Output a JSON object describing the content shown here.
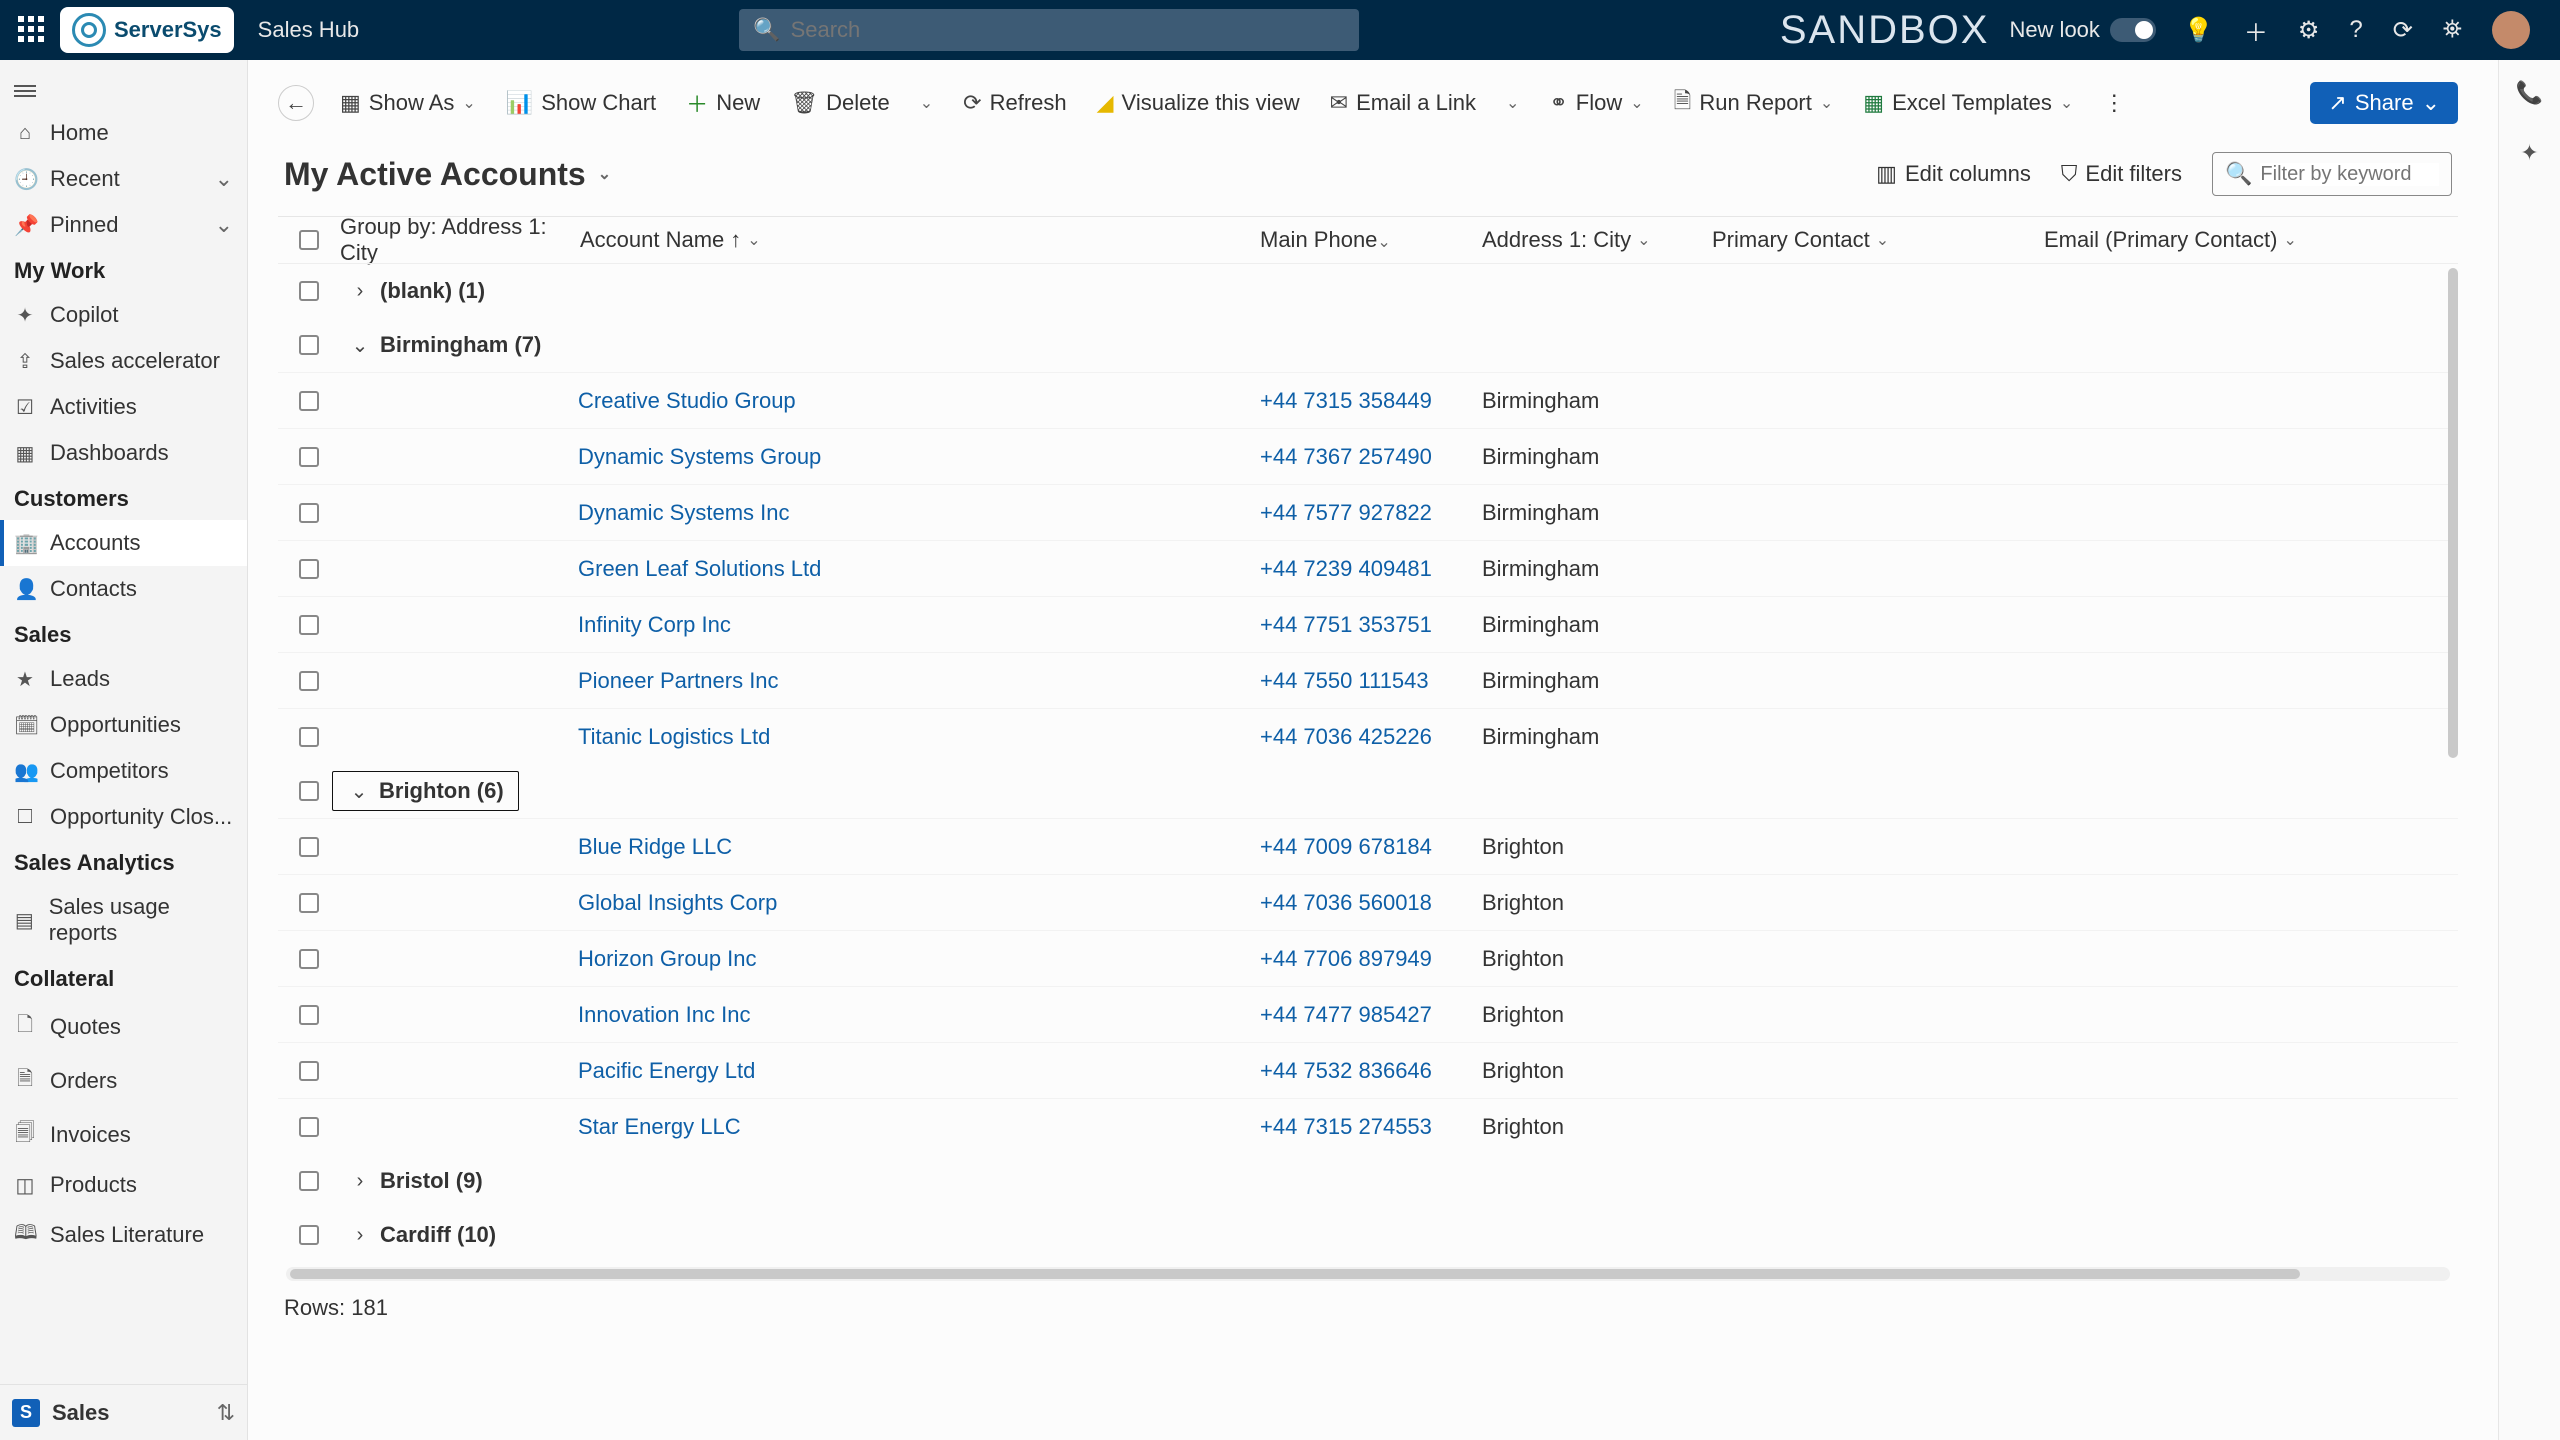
{
  "header": {
    "logo": "ServerSys",
    "app": "Sales Hub",
    "search_placeholder": "Search",
    "sandbox": "SANDBOX",
    "newlook": "New look"
  },
  "nav": {
    "top": [
      {
        "icon": "⌂",
        "label": "Home"
      },
      {
        "icon": "🕘",
        "label": "Recent",
        "chev": true
      },
      {
        "icon": "📌",
        "label": "Pinned",
        "chev": true
      }
    ],
    "sections": [
      {
        "title": "My Work",
        "items": [
          {
            "icon": "✦",
            "label": "Copilot"
          },
          {
            "icon": "⇪",
            "label": "Sales accelerator"
          },
          {
            "icon": "☑",
            "label": "Activities"
          },
          {
            "icon": "▦",
            "label": "Dashboards"
          }
        ]
      },
      {
        "title": "Customers",
        "items": [
          {
            "icon": "🏢",
            "label": "Accounts",
            "active": true
          },
          {
            "icon": "👤",
            "label": "Contacts"
          }
        ]
      },
      {
        "title": "Sales",
        "items": [
          {
            "icon": "★",
            "label": "Leads"
          },
          {
            "icon": "🗓",
            "label": "Opportunities"
          },
          {
            "icon": "👥",
            "label": "Competitors"
          },
          {
            "icon": "🞎",
            "label": "Opportunity Clos..."
          }
        ]
      },
      {
        "title": "Sales Analytics",
        "items": [
          {
            "icon": "▤",
            "label": "Sales usage reports"
          }
        ]
      },
      {
        "title": "Collateral",
        "items": [
          {
            "icon": "🗋",
            "label": "Quotes"
          },
          {
            "icon": "🗎",
            "label": "Orders"
          },
          {
            "icon": "🗐",
            "label": "Invoices"
          },
          {
            "icon": "◫",
            "label": "Products"
          },
          {
            "icon": "🕮",
            "label": "Sales Literature"
          }
        ]
      }
    ],
    "area": {
      "badge": "S",
      "label": "Sales"
    }
  },
  "cmd": {
    "showas": "Show As",
    "showchart": "Show Chart",
    "new": "New",
    "delete": "Delete",
    "refresh": "Refresh",
    "visualize": "Visualize this view",
    "email": "Email a Link",
    "flow": "Flow",
    "report": "Run Report",
    "excel": "Excel Templates",
    "share": "Share"
  },
  "view": {
    "title": "My Active Accounts",
    "editcols": "Edit columns",
    "editfilters": "Edit filters",
    "filter_placeholder": "Filter by keyword"
  },
  "cols": {
    "group": "Group by: Address 1: City",
    "name": "Account Name",
    "phone": "Main Phone",
    "city": "Address 1: City",
    "contact": "Primary Contact",
    "email": "Email (Primary Contact)"
  },
  "groups": [
    {
      "label": "(blank)",
      "count": 1,
      "expanded": false,
      "rows": []
    },
    {
      "label": "Birmingham",
      "count": 7,
      "expanded": true,
      "rows": [
        {
          "name": "Creative Studio Group",
          "phone": "+44 7315 358449",
          "city": "Birmingham"
        },
        {
          "name": "Dynamic Systems Group",
          "phone": "+44 7367 257490",
          "city": "Birmingham"
        },
        {
          "name": "Dynamic Systems Inc",
          "phone": "+44 7577 927822",
          "city": "Birmingham"
        },
        {
          "name": "Green Leaf Solutions Ltd",
          "phone": "+44 7239 409481",
          "city": "Birmingham"
        },
        {
          "name": "Infinity Corp Inc",
          "phone": "+44 7751 353751",
          "city": "Birmingham"
        },
        {
          "name": "Pioneer Partners Inc",
          "phone": "+44 7550 111543",
          "city": "Birmingham"
        },
        {
          "name": "Titanic Logistics Ltd",
          "phone": "+44 7036 425226",
          "city": "Birmingham"
        }
      ]
    },
    {
      "label": "Brighton",
      "count": 6,
      "expanded": true,
      "focused": true,
      "rows": [
        {
          "name": "Blue Ridge LLC",
          "phone": "+44 7009 678184",
          "city": "Brighton"
        },
        {
          "name": "Global Insights Corp",
          "phone": "+44 7036 560018",
          "city": "Brighton"
        },
        {
          "name": "Horizon Group Inc",
          "phone": "+44 7706 897949",
          "city": "Brighton"
        },
        {
          "name": "Innovation Inc Inc",
          "phone": "+44 7477 985427",
          "city": "Brighton"
        },
        {
          "name": "Pacific Energy Ltd",
          "phone": "+44 7532 836646",
          "city": "Brighton"
        },
        {
          "name": "Star Energy LLC",
          "phone": "+44 7315 274553",
          "city": "Brighton"
        }
      ]
    },
    {
      "label": "Bristol",
      "count": 9,
      "expanded": false,
      "rows": []
    },
    {
      "label": "Cardiff",
      "count": 10,
      "expanded": false,
      "rows": []
    }
  ],
  "footer": {
    "rows_label": "Rows: ",
    "rows": 181
  }
}
